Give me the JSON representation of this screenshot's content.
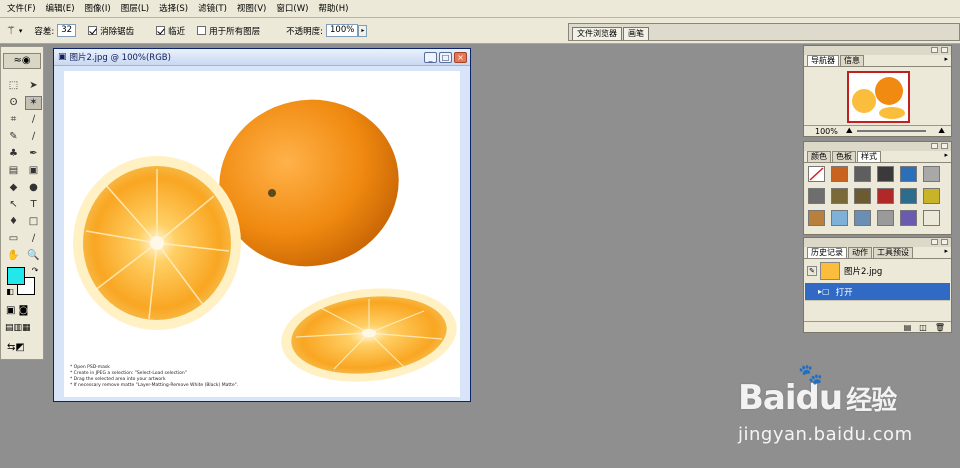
{
  "menu": [
    "文件(F)",
    "编辑(E)",
    "图像(I)",
    "图层(L)",
    "选择(S)",
    "滤镜(T)",
    "视图(V)",
    "窗口(W)",
    "帮助(H)"
  ],
  "options": {
    "tolerance_label": "容差:",
    "tolerance_value": "32",
    "antialias_label": "消除锯齿",
    "contiguous_label": "临近",
    "all_layers_label": "用于所有图层",
    "opacity_label": "不透明度:",
    "opacity_value": "100%"
  },
  "palette_well": {
    "tabs": [
      "文件浏览器",
      "画笔"
    ]
  },
  "toolbox": {
    "tools": [
      "⬚",
      "➤",
      "ʘ",
      "✶",
      "⌗",
      "∕",
      "✎",
      "∕",
      "♣",
      "✒",
      "▤",
      "▣",
      "◆",
      "●",
      "↖",
      "T",
      "♦",
      "□",
      "▭",
      "∕",
      "✋",
      "🔍"
    ],
    "foreground_color": "#22e8ec",
    "background_color": "#ffffff"
  },
  "document": {
    "title": "图片2.jpg @ 100%(RGB)",
    "notes": [
      "* Open PSD-mask",
      "* Create in JPEG a selection: \"Select-Load selection\"",
      "* Drag the selected area into your artwork",
      "* If necessary remove matte \"Layer-Matting-Remove White (Black) Matte\"."
    ]
  },
  "navigator": {
    "tabs": [
      "导航器",
      "信息"
    ],
    "zoom": "100%"
  },
  "styles": {
    "tabs": [
      "颜色",
      "色板",
      "样式"
    ],
    "swatches": [
      "#ffffff",
      "#c96420",
      "#5e5e5e",
      "#3a3a3a",
      "#2a6fb8",
      "#a8a8a8",
      "#6e6e6e",
      "#7a6a3a",
      "#6c5a30",
      "#b02828",
      "#2c6c8c",
      "#c8b428",
      "#b8803c",
      "#7fb0d8",
      "#6a8fb5",
      "#9a9a9a",
      "#6a5ab0",
      "#ece9d8"
    ]
  },
  "history": {
    "tabs": [
      "历史记录",
      "动作",
      "工具预设"
    ],
    "snapshot": "图片2.jpg",
    "step": "打开"
  },
  "watermark": {
    "brand": "Baidu",
    "brand_suffix": "经验",
    "url": "jingyan.baidu.com"
  }
}
